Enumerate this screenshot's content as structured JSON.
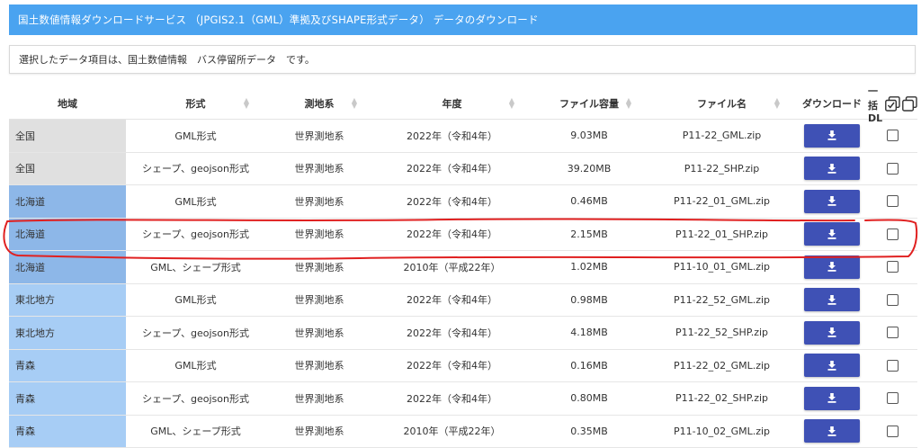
{
  "title": "国土数値情報ダウンロードサービス （JPGIS2.1（GML）準拠及びSHAPE形式データ） データのダウンロード",
  "info_text": "選択したデータ項目は、国土数値情報　バス停留所データ　です。",
  "headers": {
    "region": "地域",
    "format": "形式",
    "datum": "測地系",
    "year": "年度",
    "size": "ファイル容量",
    "filename": "ファイル名",
    "download": "ダウンロード",
    "bulk": "一括DL"
  },
  "colors": {
    "titlebar": "#4aa3f0",
    "button": "#3f51b5",
    "region_national": "#e0e0e0",
    "region_hokkaido": "#8db7e8",
    "region_other": "#a7cdf5",
    "annotation": "#e02020"
  },
  "rows": [
    {
      "region": "全国",
      "format": "GML形式",
      "datum": "世界測地系",
      "year": "2022年（令和4年）",
      "size": "9.03MB",
      "filename": "P11-22_GML.zip",
      "region_color": "#e0e0e0"
    },
    {
      "region": "全国",
      "format": "シェープ、geojson形式",
      "datum": "世界測地系",
      "year": "2022年（令和4年）",
      "size": "39.20MB",
      "filename": "P11-22_SHP.zip",
      "region_color": "#e0e0e0"
    },
    {
      "region": "北海道",
      "format": "GML形式",
      "datum": "世界測地系",
      "year": "2022年（令和4年）",
      "size": "0.46MB",
      "filename": "P11-22_01_GML.zip",
      "region_color": "#8db7e8"
    },
    {
      "region": "北海道",
      "format": "シェープ、geojson形式",
      "datum": "世界測地系",
      "year": "2022年（令和4年）",
      "size": "2.15MB",
      "filename": "P11-22_01_SHP.zip",
      "region_color": "#8db7e8"
    },
    {
      "region": "北海道",
      "format": "GML、シェープ形式",
      "datum": "世界測地系",
      "year": "2010年（平成22年）",
      "size": "1.02MB",
      "filename": "P11-10_01_GML.zip",
      "region_color": "#8db7e8"
    },
    {
      "region": "東北地方",
      "format": "GML形式",
      "datum": "世界測地系",
      "year": "2022年（令和4年）",
      "size": "0.98MB",
      "filename": "P11-22_52_GML.zip",
      "region_color": "#a7cdf5"
    },
    {
      "region": "東北地方",
      "format": "シェープ、geojson形式",
      "datum": "世界測地系",
      "year": "2022年（令和4年）",
      "size": "4.18MB",
      "filename": "P11-22_52_SHP.zip",
      "region_color": "#a7cdf5"
    },
    {
      "region": "青森",
      "format": "GML形式",
      "datum": "世界測地系",
      "year": "2022年（令和4年）",
      "size": "0.16MB",
      "filename": "P11-22_02_GML.zip",
      "region_color": "#a7cdf5"
    },
    {
      "region": "青森",
      "format": "シェープ、geojson形式",
      "datum": "世界測地系",
      "year": "2022年（令和4年）",
      "size": "0.80MB",
      "filename": "P11-22_02_SHP.zip",
      "region_color": "#a7cdf5"
    },
    {
      "region": "青森",
      "format": "GML、シェープ形式",
      "datum": "世界測地系",
      "year": "2010年（平成22年）",
      "size": "0.35MB",
      "filename": "P11-10_02_GML.zip",
      "region_color": "#a7cdf5"
    }
  ]
}
